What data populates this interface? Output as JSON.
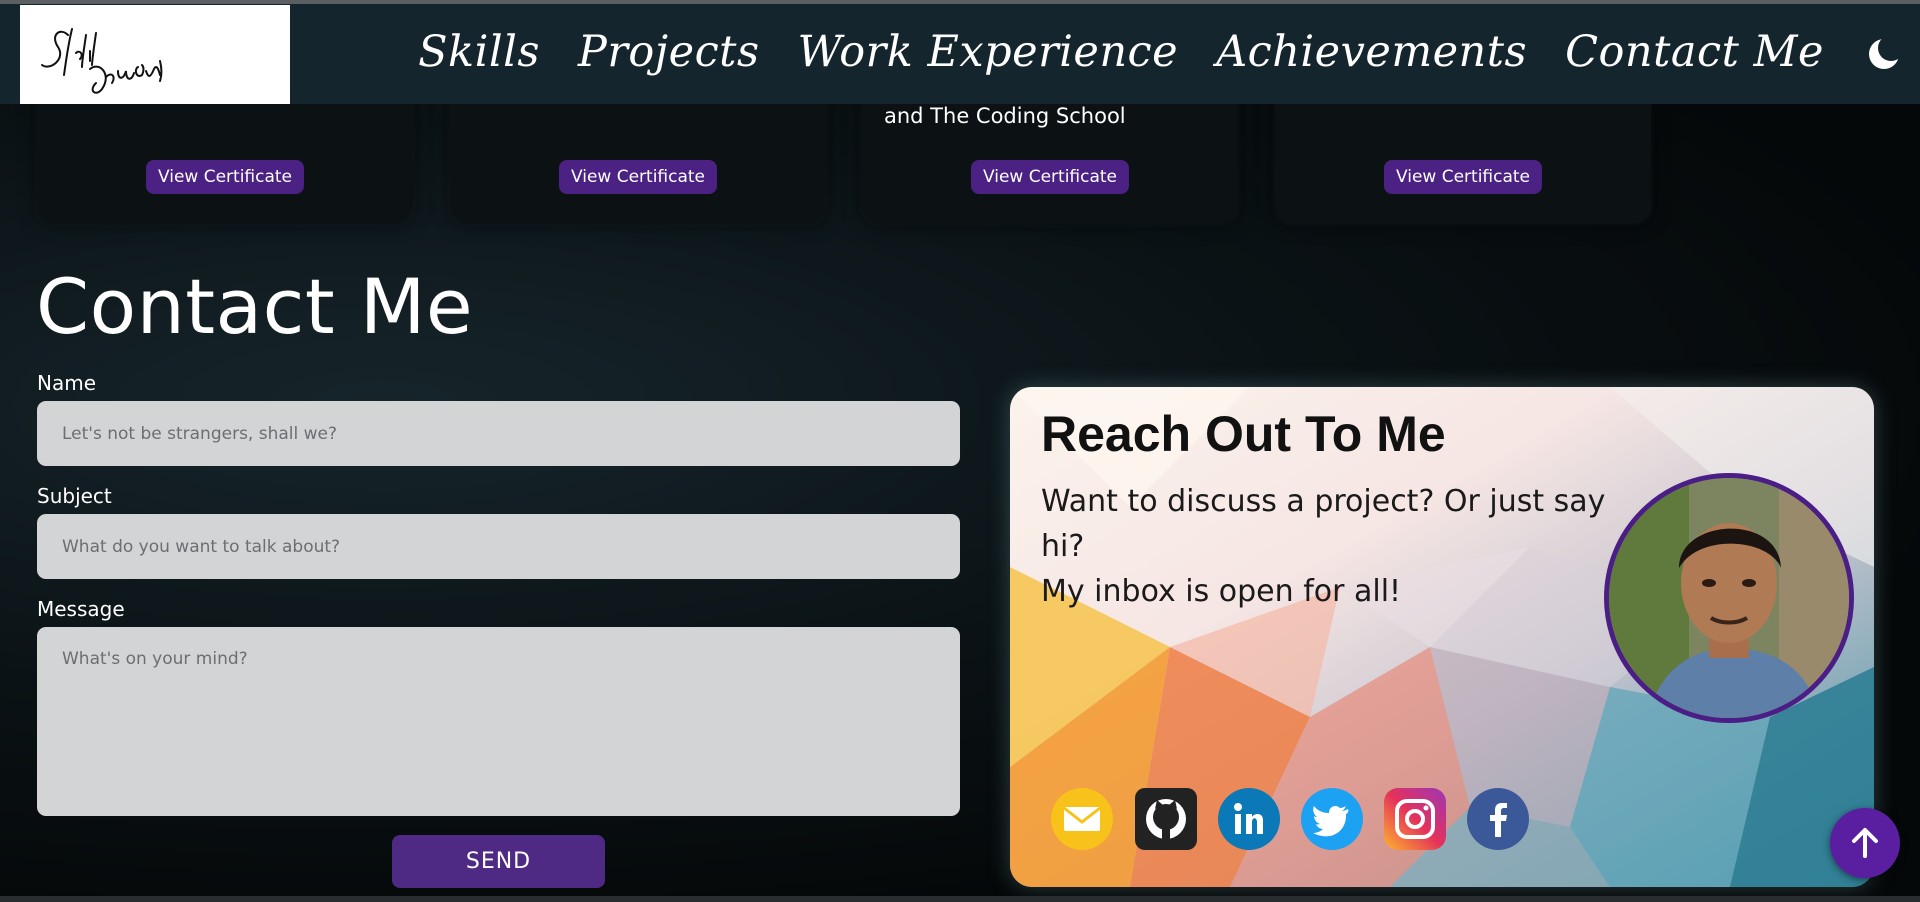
{
  "logo": {
    "alt": "Sahil Samay signature logo"
  },
  "nav": {
    "links": [
      "Skills",
      "Projects",
      "Work Experience",
      "Achievements",
      "Contact Me"
    ],
    "theme_icon": "moon-icon"
  },
  "certificates": [
    {
      "text": "",
      "button": "View Certificate"
    },
    {
      "text": "",
      "button": "View Certificate"
    },
    {
      "text": "and The Coding School",
      "button": "View Certificate"
    },
    {
      "text": "",
      "button": "View Certificate"
    }
  ],
  "contact": {
    "title": "Contact Me",
    "name_label": "Name",
    "name_placeholder": "Let's not be strangers, shall we?",
    "subject_label": "Subject",
    "subject_placeholder": "What do you want to talk about?",
    "message_label": "Message",
    "message_placeholder": "What's on your mind?",
    "send_label": "SEND"
  },
  "reach": {
    "title": "Reach Out To Me",
    "line1": "Want to discuss a project? Or just say",
    "line2": "hi?",
    "line3": "My inbox is open for all!"
  },
  "socials": [
    "mail-icon",
    "github-icon",
    "linkedin-icon",
    "twitter-icon",
    "instagram-icon",
    "facebook-icon"
  ],
  "colors": {
    "accent": "#4b2183",
    "navbar": "#15252d",
    "scroll_button": "#5a1fa0"
  }
}
